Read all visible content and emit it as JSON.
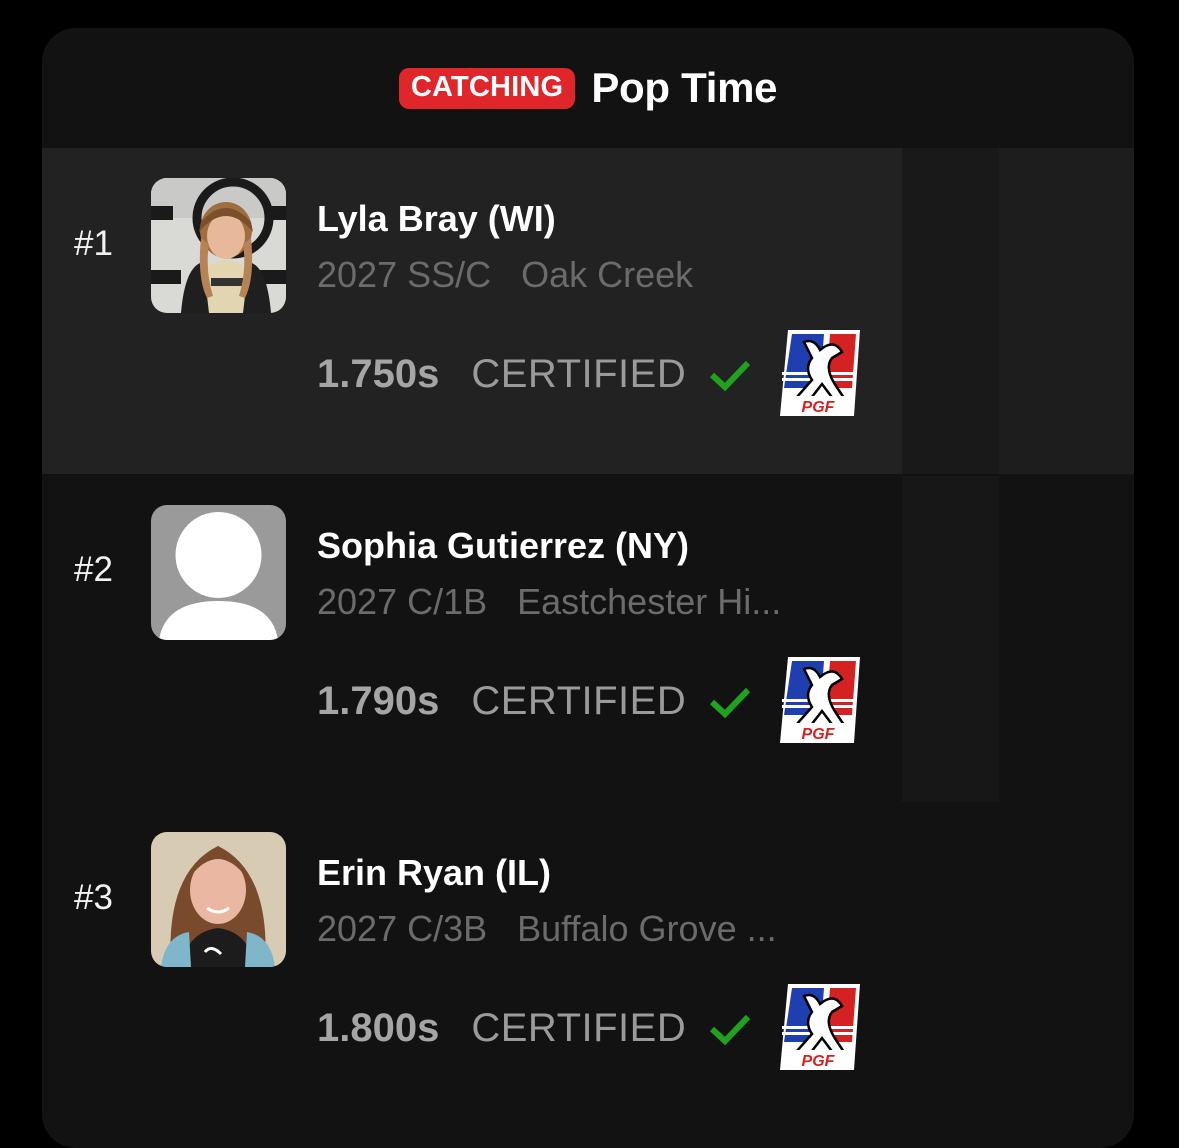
{
  "header": {
    "badge": "CATCHING",
    "title": "Pop Time"
  },
  "players": [
    {
      "rank": "#1",
      "name": "Lyla Bray (WI)",
      "class_pos": "2027 SS/C",
      "team": "Oak Creek",
      "time": "1.750s",
      "status": "CERTIFIED",
      "avatar": "player-photo",
      "highlighted": true
    },
    {
      "rank": "#2",
      "name": "Sophia Gutierrez (NY)",
      "class_pos": "2027 C/1B",
      "team": "Eastchester Hi...",
      "time": "1.790s",
      "status": "CERTIFIED",
      "avatar": "placeholder-person",
      "highlighted": false
    },
    {
      "rank": "#3",
      "name": "Erin Ryan (IL)",
      "class_pos": "2027 C/3B",
      "team": "Buffalo Grove ...",
      "time": "1.800s",
      "status": "CERTIFIED",
      "avatar": "player-photo",
      "highlighted": false
    }
  ],
  "colors": {
    "badge": "#e0262b",
    "check": "#1fa31f",
    "row_highlight": "#222222",
    "card": "#121212"
  },
  "icons": [
    "check-icon",
    "pgf-logo-icon",
    "avatar-placeholder-icon"
  ]
}
